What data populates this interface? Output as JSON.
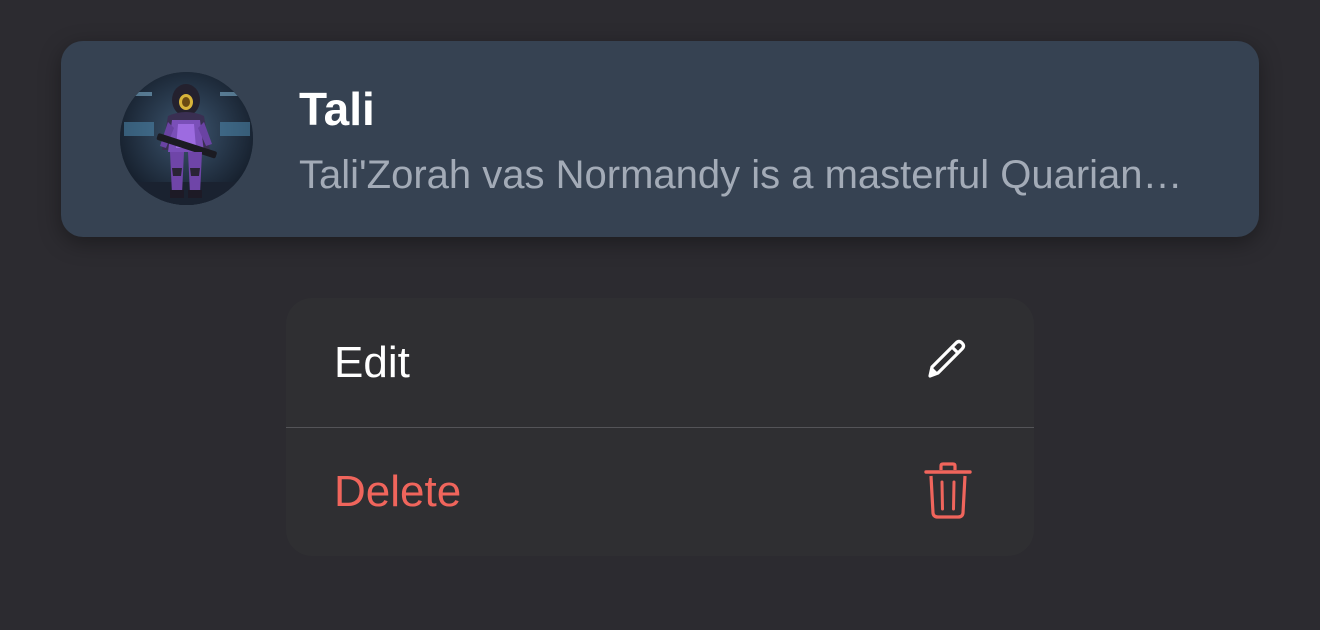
{
  "card": {
    "name": "Tali",
    "description": "Tali'Zorah vas Normandy is a masterful Quarian engineer"
  },
  "menu": {
    "edit_label": "Edit",
    "delete_label": "Delete"
  },
  "icons": {
    "edit": "pencil-icon",
    "delete": "trash-icon"
  },
  "colors": {
    "background": "#2c2b30",
    "card": "#364252",
    "menu": "#2f2f32",
    "destructive": "#f0655c",
    "secondary_text": "#a3abb7"
  }
}
